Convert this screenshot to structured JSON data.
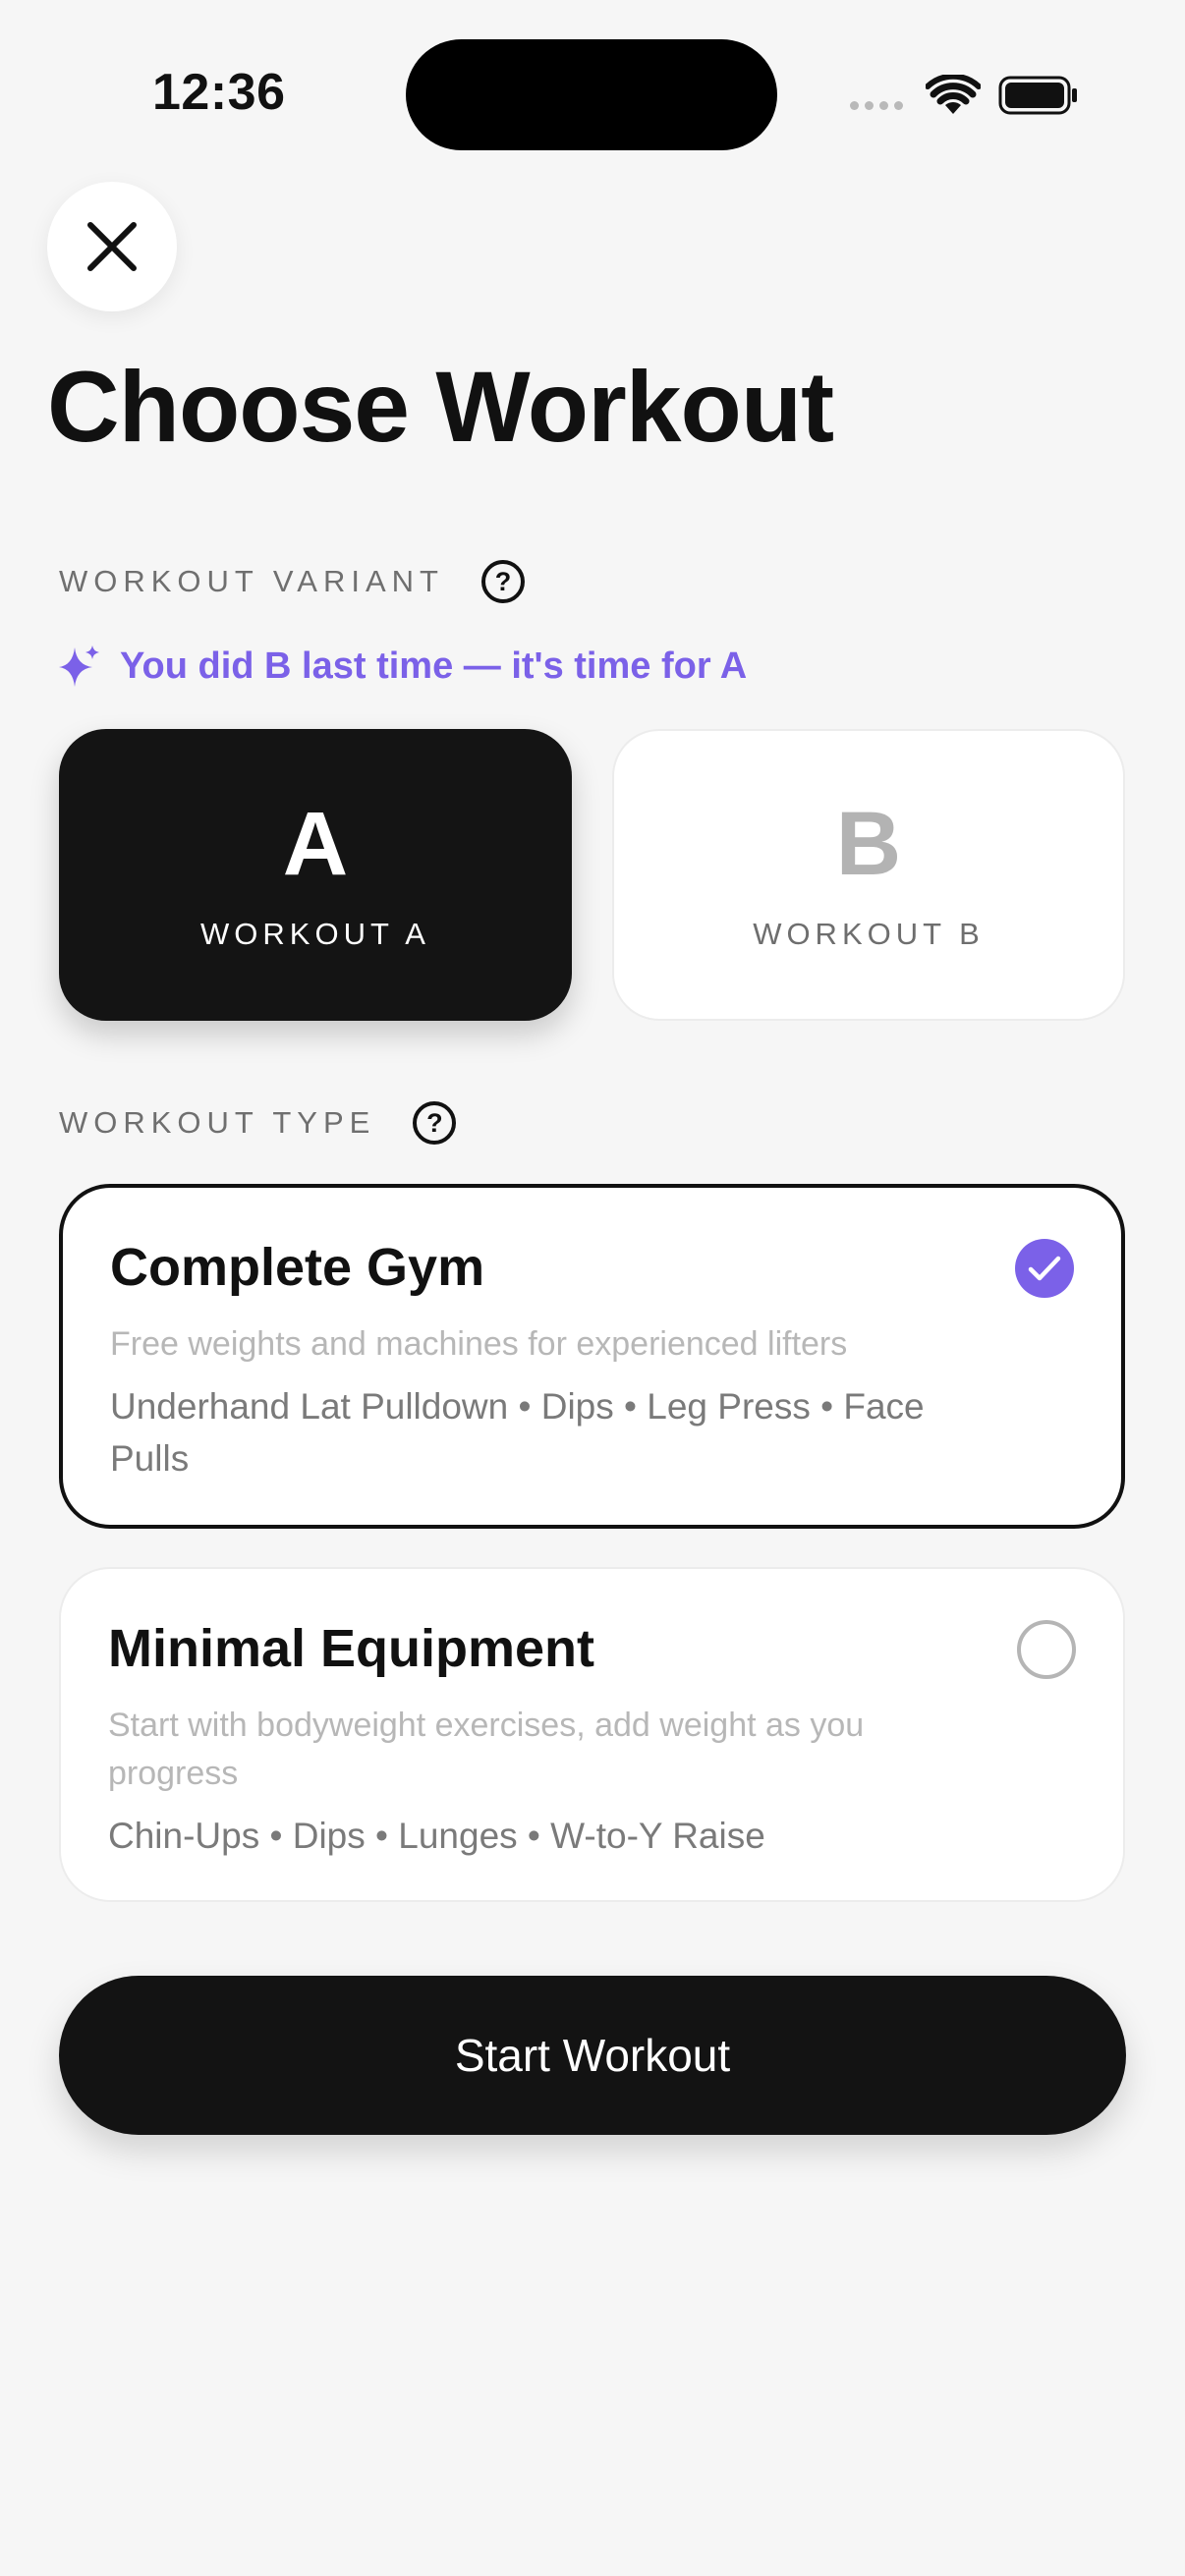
{
  "status_bar": {
    "time": "12:36"
  },
  "header": {
    "close_icon": "close-icon",
    "title": "Choose Workout"
  },
  "variant_section": {
    "label": "WORKOUT VARIANT",
    "help_glyph": "?",
    "hint": "You did B last time — it's time for A",
    "hint_icon": "sparkle-icon",
    "hint_color": "#7b61e8",
    "options": [
      {
        "letter": "A",
        "name": "WORKOUT A",
        "selected": true
      },
      {
        "letter": "B",
        "name": "WORKOUT B",
        "selected": false
      }
    ]
  },
  "type_section": {
    "label": "WORKOUT TYPE",
    "help_glyph": "?",
    "options": [
      {
        "title": "Complete Gym",
        "description": "Free weights and machines for experienced lifters",
        "exercises": "Underhand Lat Pulldown • Dips • Leg Press • Face Pulls",
        "selected": true
      },
      {
        "title": "Minimal Equipment",
        "description": "Start with bodyweight exercises, add weight as you progress",
        "exercises": "Chin-Ups • Dips • Lunges • W-to-Y Raise",
        "selected": false
      }
    ]
  },
  "actions": {
    "start_label": "Start Workout"
  },
  "colors": {
    "accent": "#7b61e8",
    "primary": "#131313",
    "background": "#f6f6f6"
  }
}
